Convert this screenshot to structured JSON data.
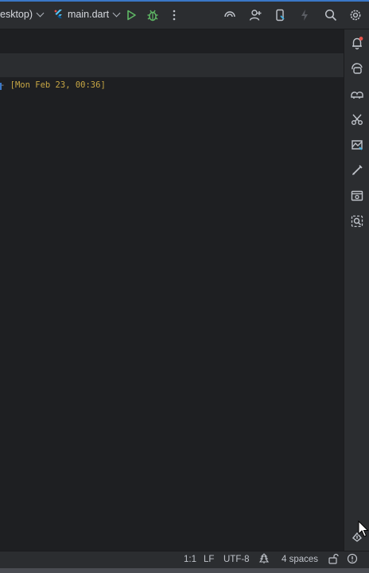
{
  "toolbar": {
    "device_label": "esktop)",
    "file_label": "main.dart"
  },
  "editor": {
    "log_dash": " - ",
    "log_timestamp": "[Mon Feb 23, 00:36]"
  },
  "statusbar": {
    "position": "1:1",
    "line_ending": "LF",
    "encoding": "UTF-8",
    "indent": "4 spaces"
  },
  "colors": {
    "accent": "#3a77c7",
    "timestamp": "#c7a644",
    "run": "#5fb865",
    "notification_dot": "#e5534b"
  }
}
